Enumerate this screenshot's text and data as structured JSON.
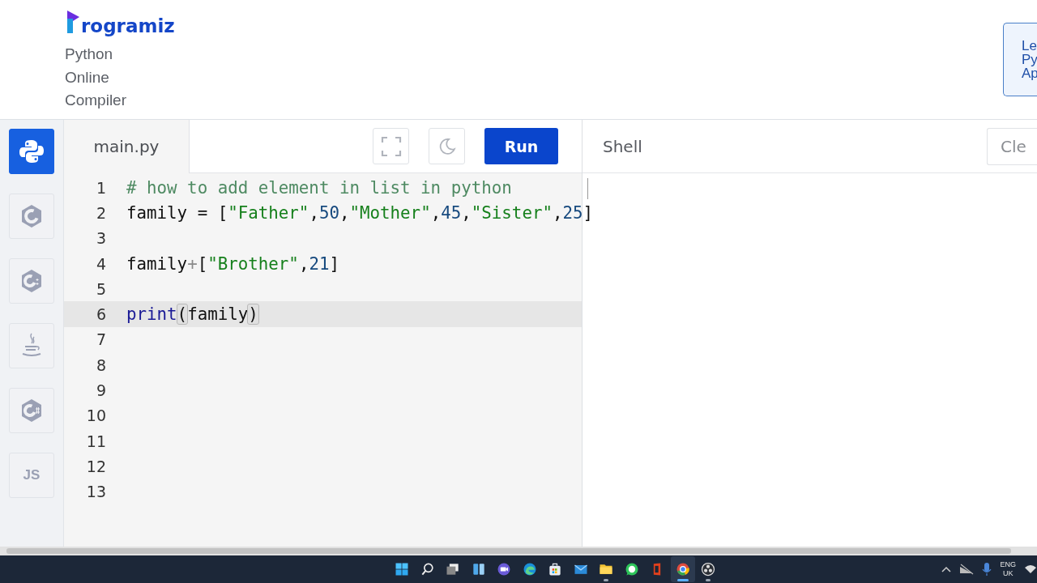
{
  "header": {
    "logo": "rogramiz",
    "title": "Python Online Compiler",
    "promo_lines": [
      "Le",
      "Py",
      "Ap"
    ]
  },
  "languages": [
    {
      "kind": "python",
      "selected": true
    },
    {
      "kind": "c",
      "selected": false
    },
    {
      "kind": "cpp",
      "selected": false
    },
    {
      "kind": "java",
      "selected": false
    },
    {
      "kind": "csharp",
      "selected": false
    },
    {
      "kind": "js",
      "label": "JS",
      "selected": false
    }
  ],
  "editor": {
    "tab": "main.py",
    "run_button": "Run",
    "lines": [
      {
        "number": "1",
        "current": false,
        "tokens": [
          {
            "text": "# how to add element in list in python",
            "kind": "comment"
          }
        ]
      },
      {
        "number": "2",
        "current": false,
        "tokens": [
          {
            "text": "family",
            "kind": "name"
          },
          {
            "text": " = [",
            "kind": "punct"
          },
          {
            "text": "\"Father\"",
            "kind": "string"
          },
          {
            "text": ",",
            "kind": "punct"
          },
          {
            "text": "50",
            "kind": "number"
          },
          {
            "text": ",",
            "kind": "punct"
          },
          {
            "text": "\"Mother\"",
            "kind": "string"
          },
          {
            "text": ",",
            "kind": "punct"
          },
          {
            "text": "45",
            "kind": "number"
          },
          {
            "text": ",",
            "kind": "punct"
          },
          {
            "text": "\"Sister\"",
            "kind": "string"
          },
          {
            "text": ",",
            "kind": "punct"
          },
          {
            "text": "25",
            "kind": "number"
          },
          {
            "text": "]",
            "kind": "punct"
          }
        ]
      },
      {
        "number": "3",
        "current": false
      },
      {
        "number": "4",
        "current": false,
        "tokens": [
          {
            "text": "family",
            "kind": "name"
          },
          {
            "text": "+",
            "kind": "operator"
          },
          {
            "text": "[",
            "kind": "punct"
          },
          {
            "text": "\"Brother\"",
            "kind": "string"
          },
          {
            "text": ",",
            "kind": "punct"
          },
          {
            "text": "21",
            "kind": "number"
          },
          {
            "text": "]",
            "kind": "punct"
          }
        ]
      },
      {
        "number": "5",
        "current": false
      },
      {
        "number": "6",
        "current": true,
        "tokens": [
          {
            "text": "print",
            "kind": "builtin"
          },
          {
            "text": "(",
            "kind": "punct",
            "matched": true
          },
          {
            "text": "family",
            "kind": "name"
          },
          {
            "text": ")",
            "kind": "punct",
            "matched": true
          }
        ]
      },
      {
        "number": "7",
        "current": false
      },
      {
        "number": "8",
        "current": false
      },
      {
        "number": "9",
        "current": false
      },
      {
        "number": "10",
        "current": false
      },
      {
        "number": "11",
        "current": false
      },
      {
        "number": "12",
        "current": false
      },
      {
        "number": "13",
        "current": false
      }
    ]
  },
  "shell": {
    "title": "Shell",
    "clear_button": "Cle"
  },
  "taskbar": {
    "apps": [
      {
        "kind": "start",
        "running": false,
        "active": false
      },
      {
        "kind": "search",
        "running": false,
        "active": false
      },
      {
        "kind": "taskview",
        "running": false,
        "active": false
      },
      {
        "kind": "widgets",
        "running": false,
        "active": false
      },
      {
        "kind": "chat",
        "running": false,
        "active": false
      },
      {
        "kind": "edge",
        "running": false,
        "active": false
      },
      {
        "kind": "store",
        "running": false,
        "active": false
      },
      {
        "kind": "mail",
        "running": false,
        "active": false
      },
      {
        "kind": "folder",
        "running": true,
        "active": false
      },
      {
        "kind": "whatsapp",
        "running": false,
        "active": false
      },
      {
        "kind": "office",
        "running": false,
        "active": false
      },
      {
        "kind": "chrome",
        "running": true,
        "active": true
      },
      {
        "kind": "obs",
        "running": true,
        "active": false
      }
    ],
    "language": "ENG",
    "region": "UK"
  }
}
